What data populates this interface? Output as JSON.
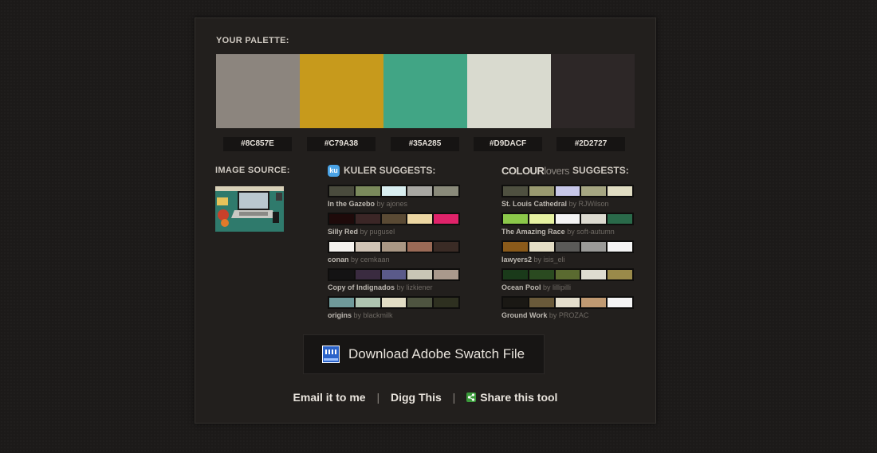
{
  "palette": {
    "heading": "YOUR PALETTE:",
    "swatches": [
      {
        "hex": "#8C857E",
        "color": "#8C857E"
      },
      {
        "hex": "#C79A38",
        "color": "#C79A1C"
      },
      {
        "hex": "#35A285",
        "color": "#41A585"
      },
      {
        "hex": "#D9DACF",
        "color": "#D9DACF"
      },
      {
        "hex": "#2D2727",
        "color": "#2D2727"
      }
    ]
  },
  "image_source": {
    "heading": "IMAGE SOURCE:"
  },
  "kuler": {
    "heading": "KULER SUGGESTS:",
    "icon_letter": "ku",
    "items": [
      {
        "name": "In the Gazebo",
        "by": "by ajones",
        "colors": [
          "#4a4b3d",
          "#7b8a5c",
          "#d9eef0",
          "#a8a7a2",
          "#8a8a7a"
        ]
      },
      {
        "name": "Silly Red",
        "by": "by pugusel",
        "colors": [
          "#1e0a0a",
          "#3b2626",
          "#5a4a34",
          "#ecd6a2",
          "#e0236a"
        ]
      },
      {
        "name": "conan",
        "by": "by cemkaan",
        "colors": [
          "#f4f2ee",
          "#cfc3b5",
          "#a99784",
          "#9a6a56",
          "#3a2b25"
        ]
      },
      {
        "name": "Copy of Indignados",
        "by": "by lizkiener",
        "colors": [
          "#141314",
          "#3a2b40",
          "#5a5a8a",
          "#c9c6b5",
          "#a9998c"
        ]
      },
      {
        "name": "origins",
        "by": "by blackmilk",
        "colors": [
          "#6f9a9a",
          "#aec4b0",
          "#e2ddc5",
          "#4e5440",
          "#2e3020"
        ]
      }
    ]
  },
  "colourlovers": {
    "brand_bold": "COLOUR",
    "brand_light": "lovers",
    "heading": "SUGGESTS:",
    "items": [
      {
        "name": "St. Louis Cathedral",
        "by": "by RJWilson",
        "colors": [
          "#4f5040",
          "#9a9a70",
          "#c8c8e8",
          "#a6a682",
          "#e0dcc2"
        ]
      },
      {
        "name": "The Amazing Race",
        "by": "by soft-autumn",
        "colors": [
          "#8cc84a",
          "#e6f2a2",
          "#f4f4f4",
          "#dcdad0",
          "#2a6a4a"
        ]
      },
      {
        "name": "lawyers2",
        "by": "by isis_eli",
        "colors": [
          "#8a5a1a",
          "#e2dcc4",
          "#5a5a58",
          "#9a9a98",
          "#f4f4f4"
        ]
      },
      {
        "name": "Ocean Pool",
        "by": "by lillipilli",
        "colors": [
          "#1a3a1a",
          "#2a4a20",
          "#5a6a30",
          "#dedcd0",
          "#9a8a4a"
        ]
      },
      {
        "name": "Ground Work",
        "by": "by PROZAC",
        "colors": [
          "#1a1814",
          "#6a5a3a",
          "#e4decc",
          "#c09a72",
          "#f4f4f4"
        ]
      }
    ]
  },
  "download": {
    "label": "Download Adobe Swatch File"
  },
  "links": {
    "email": "Email it to me",
    "separator": "|",
    "digg": "Digg This",
    "share": "Share this tool"
  }
}
